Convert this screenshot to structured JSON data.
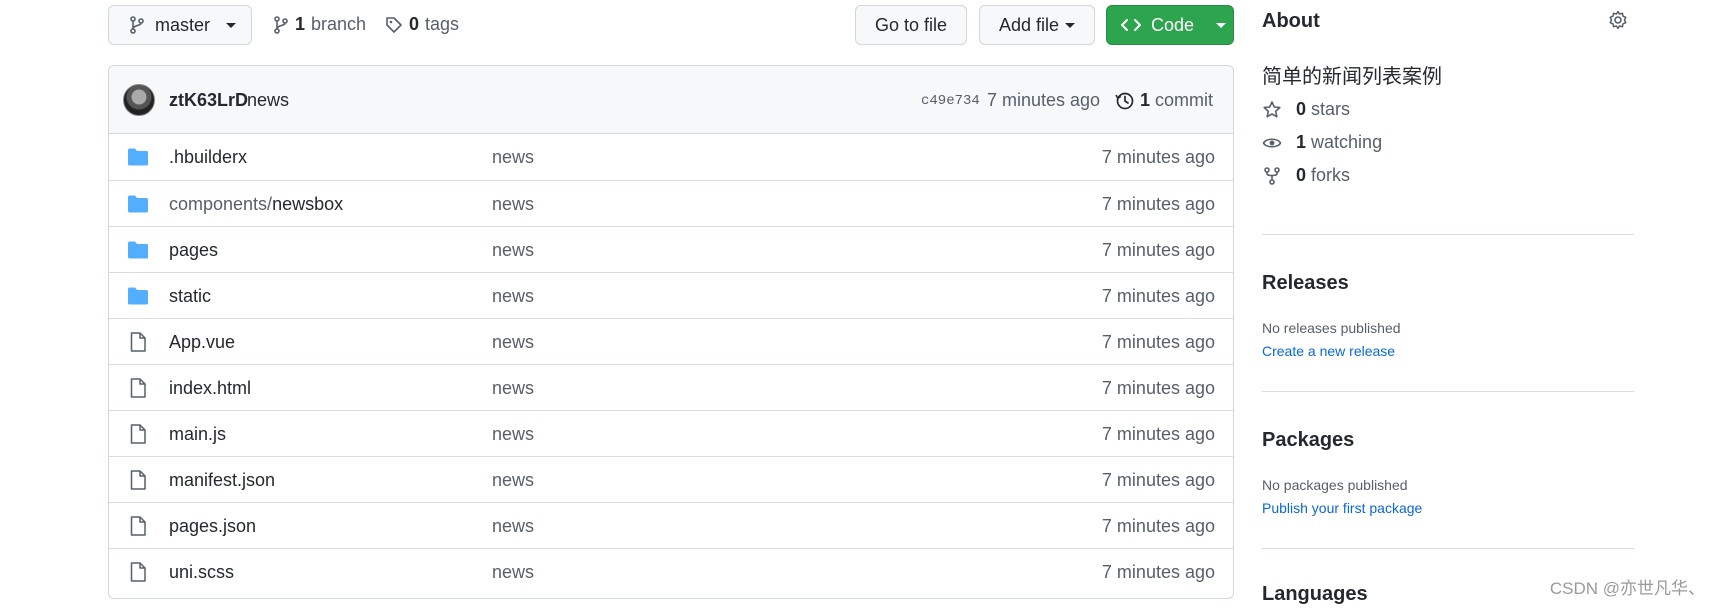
{
  "repo_bar": {
    "branch_label": "master",
    "branches_count": "1",
    "branches_label": "branch",
    "tags_count": "0",
    "tags_label": "tags",
    "goto_file_label": "Go to file",
    "add_file_label": "Add file",
    "code_label": "Code"
  },
  "commit": {
    "author": "ztK63LrD",
    "message": "news",
    "sha": "c49e734",
    "time": "7 minutes ago",
    "count": "1",
    "count_label": "commit"
  },
  "files": [
    {
      "type": "folder",
      "name_prefix": "",
      "name": ".hbuilderx",
      "message": "news",
      "time": "7 minutes ago"
    },
    {
      "type": "folder",
      "name_prefix": "components/",
      "name": "newsbox",
      "message": "news",
      "time": "7 minutes ago"
    },
    {
      "type": "folder",
      "name_prefix": "",
      "name": "pages",
      "message": "news",
      "time": "7 minutes ago"
    },
    {
      "type": "folder",
      "name_prefix": "",
      "name": "static",
      "message": "news",
      "time": "7 minutes ago"
    },
    {
      "type": "file",
      "name_prefix": "",
      "name": "App.vue",
      "message": "news",
      "time": "7 minutes ago"
    },
    {
      "type": "file",
      "name_prefix": "",
      "name": "index.html",
      "message": "news",
      "time": "7 minutes ago"
    },
    {
      "type": "file",
      "name_prefix": "",
      "name": "main.js",
      "message": "news",
      "time": "7 minutes ago"
    },
    {
      "type": "file",
      "name_prefix": "",
      "name": "manifest.json",
      "message": "news",
      "time": "7 minutes ago"
    },
    {
      "type": "file",
      "name_prefix": "",
      "name": "pages.json",
      "message": "news",
      "time": "7 minutes ago"
    },
    {
      "type": "file",
      "name_prefix": "",
      "name": "uni.scss",
      "message": "news",
      "time": "7 minutes ago"
    }
  ],
  "about": {
    "title": "About",
    "description": "简单的新闻列表案例",
    "stars_count": "0",
    "stars_label": "stars",
    "watching_count": "1",
    "watching_label": "watching",
    "forks_count": "0",
    "forks_label": "forks"
  },
  "releases": {
    "title": "Releases",
    "note": "No releases published",
    "link": "Create a new release"
  },
  "packages": {
    "title": "Packages",
    "note": "No packages published",
    "link": "Publish your first package"
  },
  "languages": {
    "title": "Languages"
  },
  "watermark": "CSDN @亦世凡华、",
  "colors": {
    "code_button": "#2da44e",
    "folder_icon": "#54aeff",
    "link": "#0969da"
  }
}
